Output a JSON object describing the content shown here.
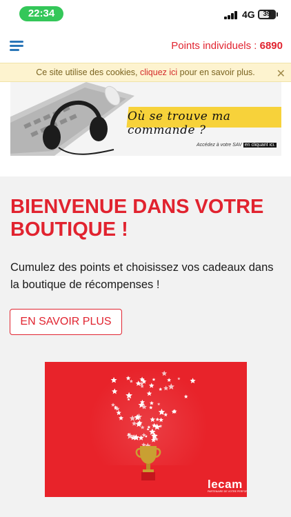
{
  "status_bar": {
    "time": "22:34",
    "network": "4G",
    "battery": "39"
  },
  "header": {
    "menu_icon": "hamburger-menu-icon",
    "points_label": "Points individuels :",
    "points_value": "6890"
  },
  "cookie_banner": {
    "text_before": "Ce site utilise des cookies,",
    "link_text": "cliquez ici",
    "text_after": "pour en savoir plus.",
    "close_icon": "close-icon"
  },
  "promo_banner": {
    "headline": "Où se trouve ma commande ?",
    "cta_text": "Accédez à votre SAV",
    "cta_link": "en cliquant ici."
  },
  "main": {
    "title": "BIENVENUE DANS VOTRE BOUTIQUE !",
    "lead": "Cumulez des points et choisissez vos cadeaux dans la boutique de récompenses !",
    "cta_label": "EN SAVOIR PLUS"
  },
  "hero": {
    "logo_word": "lecam",
    "logo_tagline": "PARTENAIRE DE VOTRE PERFORMANCE"
  },
  "colors": {
    "accent": "#e1232f",
    "menu_blue": "#2a76b8",
    "cookie_bg": "#fdf3cf"
  }
}
